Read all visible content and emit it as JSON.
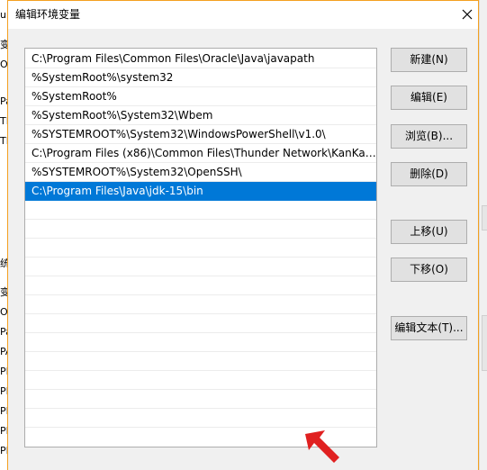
{
  "dialog": {
    "title": "编辑环境变量",
    "accent_color": "#f4a020",
    "close_icon": "close-icon"
  },
  "paths": [
    {
      "value": "C:\\Program Files\\Common Files\\Oracle\\Java\\javapath",
      "selected": false
    },
    {
      "value": "%SystemRoot%\\system32",
      "selected": false
    },
    {
      "value": "%SystemRoot%",
      "selected": false
    },
    {
      "value": "%SystemRoot%\\System32\\Wbem",
      "selected": false
    },
    {
      "value": "%SYSTEMROOT%\\System32\\WindowsPowerShell\\v1.0\\",
      "selected": false
    },
    {
      "value": "C:\\Program Files (x86)\\Common Files\\Thunder Network\\KanKan\\Codecs",
      "selected": false
    },
    {
      "value": "%SYSTEMROOT%\\System32\\OpenSSH\\",
      "selected": false
    },
    {
      "value": "C:\\Program Files\\Java\\jdk-15\\bin",
      "selected": true
    }
  ],
  "selection_color": "#0078d7",
  "buttons": {
    "new": "新建(N)",
    "edit": "编辑(E)",
    "browse": "浏览(B)...",
    "delete": "删除(D)",
    "move_up": "上移(U)",
    "move_down": "下移(O)",
    "edit_text": "编辑文本(T)..."
  },
  "background_fragments": [
    "u",
    "变",
    "O",
    "Pa",
    "TE",
    "TN",
    "统",
    "变",
    "O",
    "Pa",
    "PA",
    "PF",
    "PF",
    "PF",
    "PF",
    "PF"
  ]
}
